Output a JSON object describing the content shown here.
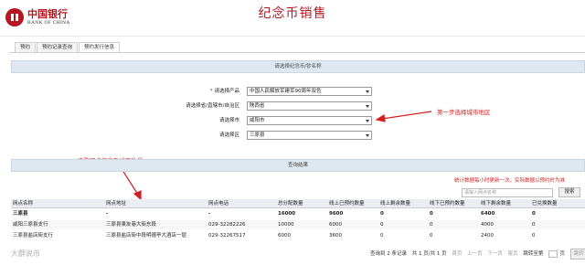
{
  "header": {
    "logo_cn": "中国银行",
    "logo_en": "BANK OF CHINA",
    "title": "纪念币销售"
  },
  "tabs": [
    {
      "label": "预约",
      "active": false
    },
    {
      "label": "预约记录查询",
      "active": false
    },
    {
      "label": "预约发行信息",
      "active": true
    }
  ],
  "form": {
    "heading": "请选择纪念币/钞名称",
    "product_label": "请选择产品",
    "product_value": "中国人民解放军建军90周年双色",
    "province_label": "请选择省/直辖市/自治区",
    "province_value": "陕西省",
    "city_label": "请选择市",
    "city_value": "咸阳市",
    "district_label": "请选择区",
    "district_value": "三原县"
  },
  "annotations": {
    "step1": "第一步选择城市地区",
    "view_info": "查看网点信息及线下数量"
  },
  "results": {
    "heading": "查询结果",
    "notice": "统计数据每小时更新一次，实际数据以预约时为准",
    "search_placeholder": "请输入网点名称",
    "search_button": "搜索",
    "columns": [
      "网点名称",
      "网点地址",
      "网点电话",
      "总分配数量",
      "线上已预约数量",
      "线上剩余数量",
      "线下已预约数量",
      "线下剩余数量",
      "已兑换数量"
    ],
    "rows": [
      {
        "name": "三原县",
        "address": "-",
        "phone": "-",
        "total": "16000",
        "online_booked": "9600",
        "online_left": "0",
        "offline_booked": "0",
        "offline_left": "6400",
        "exchanged": "0"
      },
      {
        "name": "咸阳三原县支行",
        "address": "三原县東友巷大街东段",
        "phone": "029-32282226",
        "total": "10000",
        "online_booked": "6000",
        "online_left": "0",
        "offline_booked": "0",
        "offline_left": "4000",
        "exchanged": "0"
      },
      {
        "name": "三原县盐店街支行",
        "address": "三原县盐店街中段明德亭大酒店一层",
        "phone": "029-32267517",
        "total": "6000",
        "online_booked": "3600",
        "online_left": "0",
        "offline_booked": "0",
        "offline_left": "2400",
        "exchanged": "0"
      }
    ]
  },
  "pager": {
    "summary": "查询到 2 条记录",
    "pages": "共 1 页/共 1 页",
    "first": "首页",
    "prev": "上一页",
    "next": "下一页",
    "last": "尾页",
    "goto": "跳转至第",
    "page_unit": "页",
    "goto_button": "跳转"
  },
  "watermark": "大群说币",
  "colors": {
    "brand": "#b51621",
    "annotation": "#d21f1f",
    "panel_header": "#dfe8f0"
  }
}
